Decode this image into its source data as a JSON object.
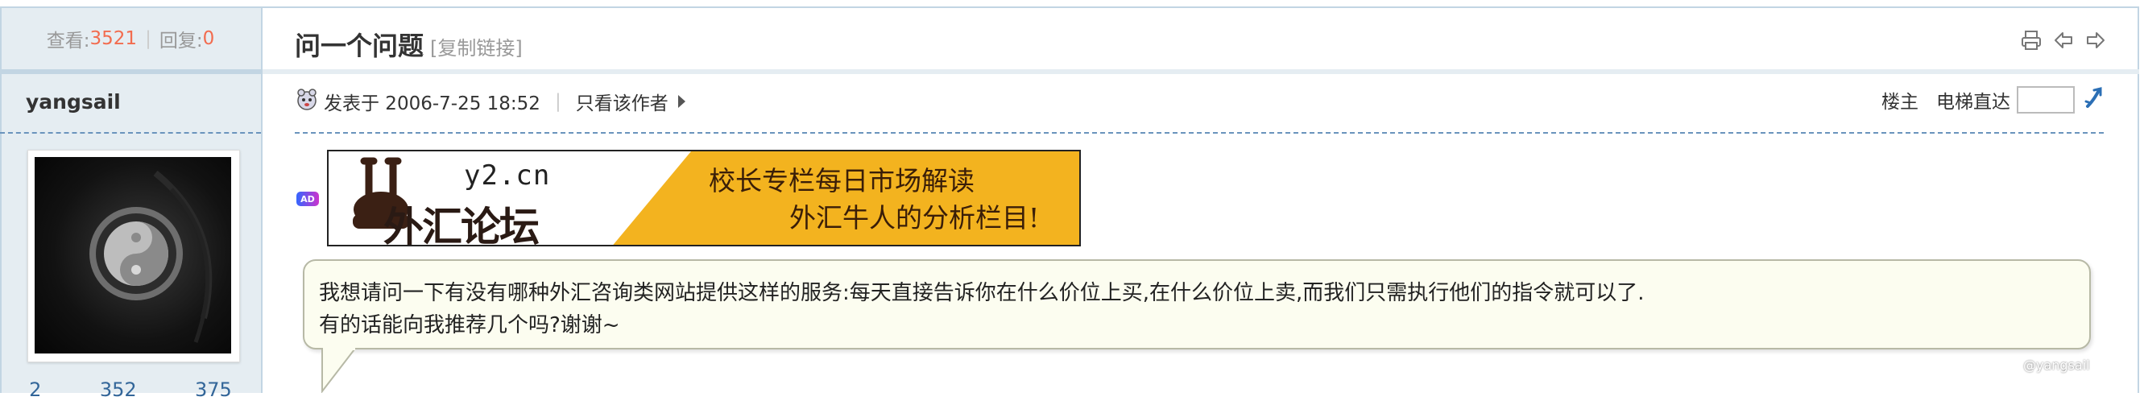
{
  "sidebar": {
    "views_label": "查看:",
    "views": "3521",
    "replies_label": "回复:",
    "replies": "0",
    "author": "yangsail",
    "bottom_stats": [
      "2",
      "352",
      "375"
    ]
  },
  "thread": {
    "title": "问一个问题",
    "copy_link": "[复制链接]"
  },
  "toolbar_icons": [
    "print-icon",
    "prev-thread-icon",
    "next-thread-icon"
  ],
  "post": {
    "posted_at": "发表于 2006-7-25 18:52",
    "only_author": "只看该作者",
    "floor": "楼主",
    "jump_label": "电梯直达",
    "jump_value": ""
  },
  "ad": {
    "badge": "AD",
    "site": "y2.cn",
    "forum_name": "外汇论坛",
    "line1": "校长专栏每日市场解读",
    "line2": "外汇牛人的分析栏目!",
    "colors": {
      "yellow": "#f3b31f",
      "white": "#ffffff"
    }
  },
  "message": {
    "line1": "我想请问一下有没有哪种外汇咨询类网站提供这样的服务:每天直接告诉你在什么价位上买,在什么价位上卖,而我们只需执行他们的指令就可以了.",
    "line2": "有的话能向我推荐几个吗?谢谢~"
  },
  "watermark": "@yangsail",
  "colors": {
    "border": "#c2d5e3",
    "sidebar_bg": "#e5edf2",
    "accent": "#f26c4f",
    "dash": "#6a94bd"
  }
}
